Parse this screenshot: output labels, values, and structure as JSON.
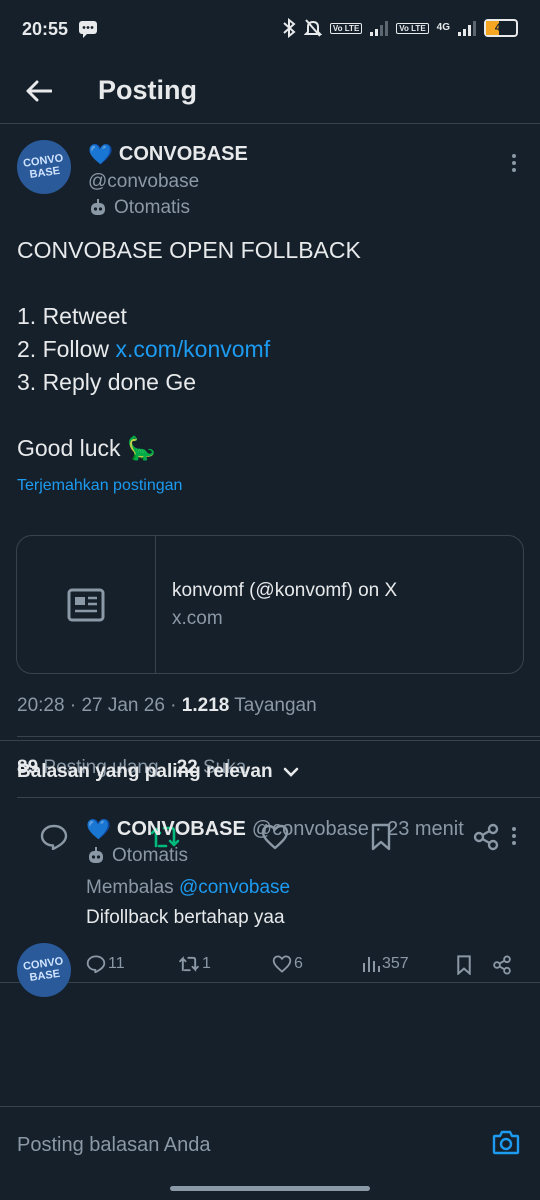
{
  "status_bar": {
    "time": "20:55",
    "battery": "44",
    "network": "4G",
    "volte": "Vo LTE"
  },
  "header": {
    "title": "Posting"
  },
  "tweet": {
    "avatar_text": "CONVO BASE",
    "display_name": "CONVOBASE",
    "name_emoji": "💙",
    "handle": "@convobase",
    "automated_label": "Otomatis",
    "text_line1": "CONVOBASE OPEN FOLLBACK",
    "text_line2": "1. Retweet",
    "text_line3_prefix": "2. Follow ",
    "text_line3_link": "x.com/konvomf",
    "text_line4": "3. Reply done Ge",
    "text_line5": "Good luck 🦕",
    "translate_label": "Terjemahkan postingan",
    "card": {
      "title": "konvomf (@konvomf) on X",
      "domain": "x.com"
    },
    "time": "20:28",
    "date": "27 Jan 26",
    "views": "1.218",
    "views_label": "Tayangan",
    "reposts": "89",
    "reposts_label": "Posting ulang",
    "likes": "22",
    "likes_label": "Suka"
  },
  "replies_header": {
    "label": "Balasan yang paling relevan"
  },
  "reply": {
    "name_emoji": "💙",
    "display_name": "CONVOBASE",
    "handle": "@convobase",
    "time_ago": "· 23 menit",
    "automated_label": "Otomatis",
    "replying_prefix": "Membalas",
    "replying_to": "@convobase",
    "text": "Difollback bertahap yaa",
    "reply_count": "11",
    "repost_count": "1",
    "like_count": "6",
    "view_count": "357"
  },
  "compose": {
    "placeholder": "Posting balasan Anda"
  },
  "colors": {
    "background": "#15202b",
    "accent": "#1d9bf0",
    "repost_active": "#00ba7c",
    "muted": "#8b98a5"
  }
}
